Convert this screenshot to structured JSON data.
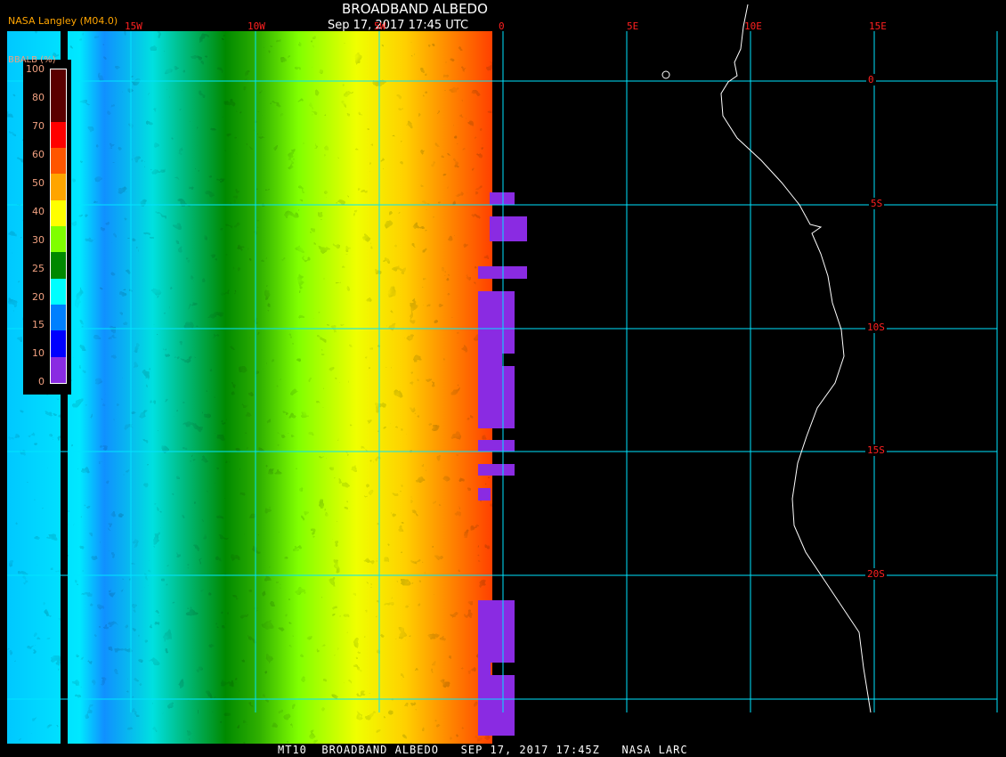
{
  "header": {
    "title": "BROADBAND ALBEDO",
    "datetime": "Sep 17, 2017 17:45 UTC",
    "source": "NASA Langley (M04.0)"
  },
  "lon_labels": [
    "15W",
    "10W",
    "5W",
    "0",
    "5E",
    "10E",
    "15E"
  ],
  "lat_labels": [
    "0",
    "5S",
    "10S",
    "15S",
    "20S"
  ],
  "colorbar": {
    "label": "BBALB (%)",
    "ticks": [
      "100",
      "80",
      "70",
      "60",
      "50",
      "40",
      "30",
      "25",
      "20",
      "15",
      "10",
      "0"
    ],
    "colors": [
      "#8a2be2",
      "#0000ff",
      "#0080ff",
      "#00ffff",
      "#008800",
      "#80ff00",
      "#ffff00",
      "#ffa500",
      "#ff5500",
      "#ff0000",
      "#5a0000"
    ]
  },
  "footer": "MT10  BROADBAND ALBEDO   SEP 17, 2017 17:45Z   NASA LARC",
  "colors": {
    "grid": "#00e5ff",
    "coast": "#ffffff",
    "missing": "#8a2be2"
  }
}
